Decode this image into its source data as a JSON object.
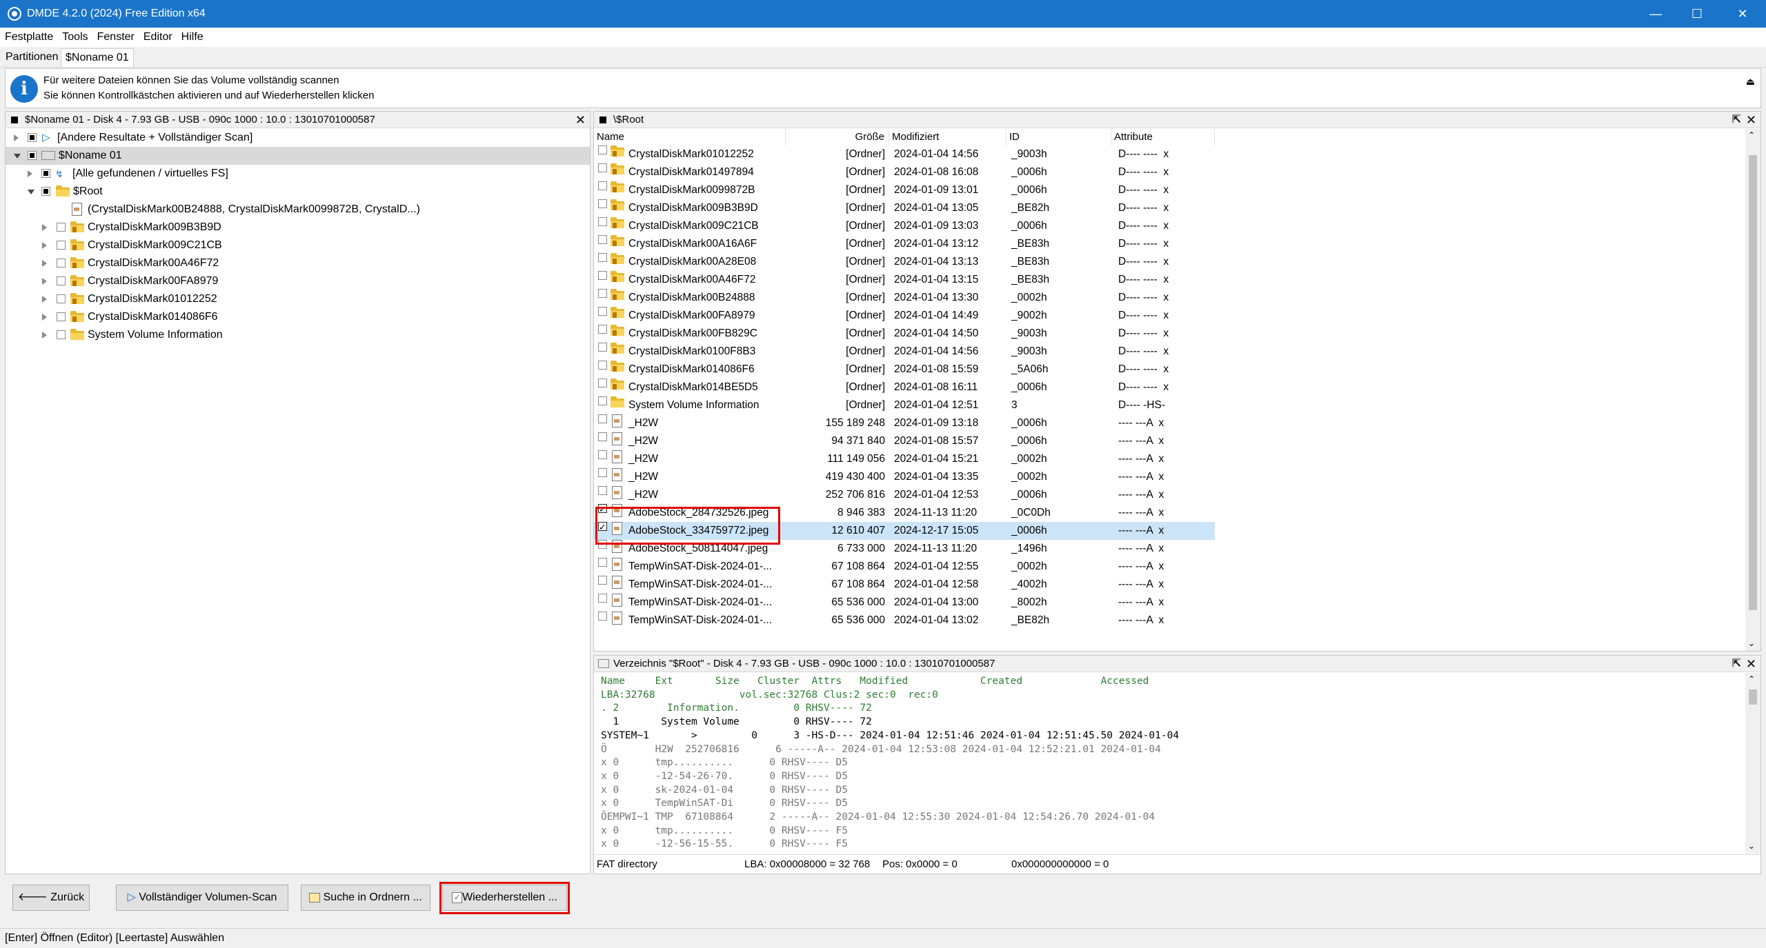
{
  "window": {
    "title": "DMDE 4.2.0 (2024) Free Edition x64",
    "minimize": "—",
    "maximize": "☐",
    "close": "✕"
  },
  "menu": [
    "Festplatte",
    "Tools",
    "Fenster",
    "Editor",
    "Hilfe"
  ],
  "tabs": [
    "Partitionen",
    "$Noname 01"
  ],
  "info": {
    "line1": "Für weitere Dateien können Sie das Volume vollständig scannen",
    "line2": "Sie können Kontrollkästchen aktivieren und auf Wiederherstellen klicken"
  },
  "left_panel": {
    "header": "$Noname 01 - Disk 4 - 7.93 GB - USB - 090c 1000 : 10.0 : 13010701000587",
    "tree": [
      {
        "label": "[Andere Resultate + Vollständiger Scan]"
      },
      {
        "label": "$Noname 01"
      },
      {
        "label": "[Alle gefundenen / virtuelles FS]"
      },
      {
        "label": "$Root"
      },
      {
        "label": "(CrystalDiskMark00B24888, CrystalDiskMark0099872B, CrystalD...)"
      },
      {
        "label": "CrystalDiskMark009B3B9D"
      },
      {
        "label": "CrystalDiskMark009C21CB"
      },
      {
        "label": "CrystalDiskMark00A46F72"
      },
      {
        "label": "CrystalDiskMark00FA8979"
      },
      {
        "label": "CrystalDiskMark01012252"
      },
      {
        "label": "CrystalDiskMark014086F6"
      },
      {
        "label": "System Volume Information"
      }
    ]
  },
  "file_panel": {
    "header": "\\$Root",
    "columns": [
      "Name",
      "Größe",
      "Modifiziert",
      "ID",
      "Attribute"
    ],
    "rows": [
      {
        "name": "CrystalDiskMark01012252",
        "size": "[Ordner]",
        "modified": "2024-01-04 14:56",
        "id": "_9003h",
        "attr": "D---- ----  x",
        "type": "folder",
        "checked": false
      },
      {
        "name": "CrystalDiskMark01497894",
        "size": "[Ordner]",
        "modified": "2024-01-08 16:08",
        "id": "_0006h",
        "attr": "D---- ----  x",
        "type": "folder",
        "checked": false
      },
      {
        "name": "CrystalDiskMark0099872B",
        "size": "[Ordner]",
        "modified": "2024-01-09 13:01",
        "id": "_0006h",
        "attr": "D---- ----  x",
        "type": "folder",
        "checked": false
      },
      {
        "name": "CrystalDiskMark009B3B9D",
        "size": "[Ordner]",
        "modified": "2024-01-04 13:05",
        "id": "_BE82h",
        "attr": "D---- ----  x",
        "type": "folder",
        "checked": false
      },
      {
        "name": "CrystalDiskMark009C21CB",
        "size": "[Ordner]",
        "modified": "2024-01-09 13:03",
        "id": "_0006h",
        "attr": "D---- ----  x",
        "type": "folder",
        "checked": false
      },
      {
        "name": "CrystalDiskMark00A16A6F",
        "size": "[Ordner]",
        "modified": "2024-01-04 13:12",
        "id": "_BE83h",
        "attr": "D---- ----  x",
        "type": "folder",
        "checked": false
      },
      {
        "name": "CrystalDiskMark00A28E08",
        "size": "[Ordner]",
        "modified": "2024-01-04 13:13",
        "id": "_BE83h",
        "attr": "D---- ----  x",
        "type": "folder",
        "checked": false
      },
      {
        "name": "CrystalDiskMark00A46F72",
        "size": "[Ordner]",
        "modified": "2024-01-04 13:15",
        "id": "_BE83h",
        "attr": "D---- ----  x",
        "type": "folder",
        "checked": false
      },
      {
        "name": "CrystalDiskMark00B24888",
        "size": "[Ordner]",
        "modified": "2024-01-04 13:30",
        "id": "_0002h",
        "attr": "D---- ----  x",
        "type": "folder",
        "checked": false
      },
      {
        "name": "CrystalDiskMark00FA8979",
        "size": "[Ordner]",
        "modified": "2024-01-04 14:49",
        "id": "_9002h",
        "attr": "D---- ----  x",
        "type": "folder",
        "checked": false
      },
      {
        "name": "CrystalDiskMark00FB829C",
        "size": "[Ordner]",
        "modified": "2024-01-04 14:50",
        "id": "_9003h",
        "attr": "D---- ----  x",
        "type": "folder",
        "checked": false
      },
      {
        "name": "CrystalDiskMark0100F8B3",
        "size": "[Ordner]",
        "modified": "2024-01-04 14:56",
        "id": "_9003h",
        "attr": "D---- ----  x",
        "type": "folder",
        "checked": false
      },
      {
        "name": "CrystalDiskMark014086F6",
        "size": "[Ordner]",
        "modified": "2024-01-08 15:59",
        "id": "_5A06h",
        "attr": "D---- ----  x",
        "type": "folder",
        "checked": false
      },
      {
        "name": "CrystalDiskMark014BE5D5",
        "size": "[Ordner]",
        "modified": "2024-01-08 16:11",
        "id": "_0006h",
        "attr": "D---- ----  x",
        "type": "folder",
        "checked": false
      },
      {
        "name": "System Volume Information",
        "size": "[Ordner]",
        "modified": "2024-01-04 12:51",
        "id": "3",
        "attr": "D---- -HS-",
        "type": "folder",
        "checked": false
      },
      {
        "name": "_H2W",
        "size": "155 189 248",
        "modified": "2024-01-09 13:18",
        "id": "_0006h",
        "attr": "---- ---A  x",
        "type": "file",
        "checked": false
      },
      {
        "name": "_H2W",
        "size": "94 371 840",
        "modified": "2024-01-08 15:57",
        "id": "_0006h",
        "attr": "---- ---A  x",
        "type": "file",
        "checked": false
      },
      {
        "name": "_H2W",
        "size": "111 149 056",
        "modified": "2024-01-04 15:21",
        "id": "_0002h",
        "attr": "---- ---A  x",
        "type": "file",
        "checked": false
      },
      {
        "name": "_H2W",
        "size": "419 430 400",
        "modified": "2024-01-04 13:35",
        "id": "_0002h",
        "attr": "---- ---A  x",
        "type": "file",
        "checked": false
      },
      {
        "name": "_H2W",
        "size": "252 706 816",
        "modified": "2024-01-04 12:53",
        "id": "_0006h",
        "attr": "---- ---A  x",
        "type": "file",
        "checked": false
      },
      {
        "name": "AdobeStock_284732526.jpeg",
        "size": "8 946 383",
        "modified": "2024-11-13 11:20",
        "id": "_0C0Dh",
        "attr": "---- ---A  x",
        "type": "file",
        "checked": true
      },
      {
        "name": "AdobeStock_334759772.jpeg",
        "size": "12 610 407",
        "modified": "2024-12-17 15:05",
        "id": "_0006h",
        "attr": "---- ---A  x",
        "type": "file",
        "checked": true,
        "selected": true
      },
      {
        "name": "AdobeStock_508114047.jpeg",
        "size": "6 733 000",
        "modified": "2024-11-13 11:20",
        "id": "_1496h",
        "attr": "---- ---A  x",
        "type": "file",
        "checked": false
      },
      {
        "name": "TempWinSAT-Disk-2024-01-...",
        "size": "67 108 864",
        "modified": "2024-01-04 12:55",
        "id": "_0002h",
        "attr": "---- ---A  x",
        "type": "file",
        "checked": false
      },
      {
        "name": "TempWinSAT-Disk-2024-01-...",
        "size": "67 108 864",
        "modified": "2024-01-04 12:58",
        "id": "_4002h",
        "attr": "---- ---A  x",
        "type": "file",
        "checked": false
      },
      {
        "name": "TempWinSAT-Disk-2024-01-...",
        "size": "65 536 000",
        "modified": "2024-01-04 13:00",
        "id": "_8002h",
        "attr": "---- ---A  x",
        "type": "file",
        "checked": false
      },
      {
        "name": "TempWinSAT-Disk-2024-01-...",
        "size": "65 536 000",
        "modified": "2024-01-04 13:02",
        "id": "_BE82h",
        "attr": "---- ---A  x",
        "type": "file",
        "checked": false
      }
    ]
  },
  "dir_panel": {
    "header": "Verzeichnis \"$Root\" - Disk 4 - 7.93 GB - USB - 090c 1000 : 10.0 : 13010701000587",
    "lines": [
      {
        "text": "Name     Ext       Size   Cluster  Attrs   Modified            Created             Accessed",
        "color": "#2e7d32"
      },
      {
        "text": "LBA:32768              vol.sec:32768 Clus:2 sec:0  rec:0",
        "color": "#2e7d32"
      },
      {
        "text": ". 2        Information.         0 RHSV---- 72",
        "color": "#2e7d32"
      },
      {
        "text": "  1       System Volume         0 RHSV---- 72",
        "color": "#000000"
      },
      {
        "text": "SYSTEM~1       >         0      3 -HS-D--- 2024-01-04 12:51:46 2024-01-04 12:51:45.50 2024-01-04",
        "color": "#000000"
      },
      {
        "text": "Ö        H2W  252706816      6 -----A-- 2024-01-04 12:53:08 2024-01-04 12:52:21.01 2024-01-04",
        "color": "#777777"
      },
      {
        "text": "x 0      tmp..........      0 RHSV---- D5",
        "color": "#777777"
      },
      {
        "text": "x 0      -12-54-26-70.      0 RHSV---- D5",
        "color": "#777777"
      },
      {
        "text": "x 0      sk-2024-01-04      0 RHSV---- D5",
        "color": "#777777"
      },
      {
        "text": "x 0      TempWinSAT-Di      0 RHSV---- D5",
        "color": "#777777"
      },
      {
        "text": "ÕEMPWI~1 TMP  67108864      2 -----A-- 2024-01-04 12:55:30 2024-01-04 12:54:26.70 2024-01-04",
        "color": "#777777"
      },
      {
        "text": "x 0      tmp..........      0 RHSV---- F5",
        "color": "#777777"
      },
      {
        "text": "x 0      -12-56-15-55.      0 RHSV---- F5",
        "color": "#777777"
      }
    ],
    "footer": {
      "left": "FAT directory",
      "lba": "LBA: 0x00008000 = 32 768",
      "pos": "Pos: 0x0000 = 0",
      "hex": "0x000000000000 = 0"
    }
  },
  "buttons": {
    "back": "Zurück",
    "scan": "Vollständiger Volumen-Scan",
    "search": "Suche in Ordnern ...",
    "restore": "Wiederherstellen ..."
  },
  "statusbar": "[Enter] Öffnen (Editor)  [Leertaste] Auswählen",
  "colors": {
    "titlebar": "#1a74c9",
    "highlight": "#e00000",
    "selection": "#cce4f7"
  }
}
